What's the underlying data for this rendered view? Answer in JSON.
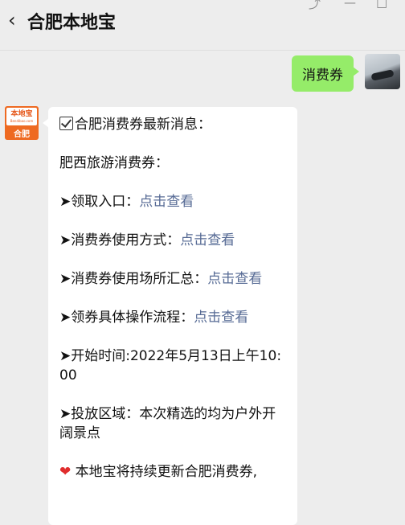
{
  "header": {
    "back_icon": "chevron-left-icon",
    "title": "合肥本地宝"
  },
  "window_controls": [
    "pin-icon",
    "minimize-icon",
    "maximize-icon"
  ],
  "messages": {
    "sent": {
      "text": "消费券"
    },
    "reply": {
      "bot_avatar": {
        "name": "本地宝",
        "site": "Bendibao.com",
        "city": "合肥"
      },
      "headline": "合肥消费券最新消息：",
      "subtitle": "肥西旅游消费券：",
      "items": [
        {
          "label": "➤领取入口：",
          "link": "点击查看"
        },
        {
          "label": "➤消费券使用方式：",
          "link": "点击查看"
        },
        {
          "label": "➤消费券使用场所汇总：",
          "link": "点击查看"
        },
        {
          "label": "➤领券具体操作流程：",
          "link": "点击查看"
        }
      ],
      "start_time_line1": "➤开始时间:2022年5月13日上午10:",
      "start_time_line2": "00",
      "area_line1": "➤投放区域：本次精选的均为户外开",
      "area_line2": "阔景点",
      "footer_icon": "heart-icon",
      "footer": "本地宝将持续更新合肥消费券,"
    }
  }
}
